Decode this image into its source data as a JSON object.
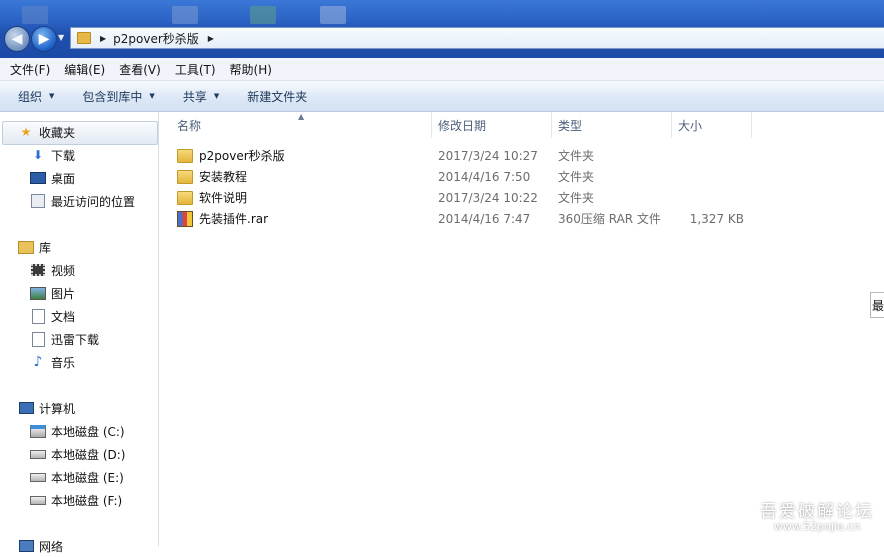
{
  "window": {
    "address_path": "p2pover秒杀版"
  },
  "menu": [
    "文件(F)",
    "编辑(E)",
    "查看(V)",
    "工具(T)",
    "帮助(H)"
  ],
  "toolbar": {
    "organize": "组织",
    "include_in_library": "包含到库中",
    "share": "共享",
    "new_folder": "新建文件夹"
  },
  "nav": {
    "favorites": "收藏夹",
    "downloads": "下载",
    "desktop": "桌面",
    "recent": "最近访问的位置",
    "libraries": "库",
    "videos": "视频",
    "pictures": "图片",
    "documents": "文档",
    "xunlei": "迅雷下载",
    "music": "音乐",
    "computer": "计算机",
    "drive_c": "本地磁盘 (C:)",
    "drive_d": "本地磁盘 (D:)",
    "drive_e": "本地磁盘 (E:)",
    "drive_f": "本地磁盘 (F:)",
    "network": "网络"
  },
  "columns": {
    "name": "名称",
    "modified": "修改日期",
    "type": "类型",
    "size": "大小"
  },
  "files": [
    {
      "name": "p2pover秒杀版",
      "modified": "2017/3/24 10:27",
      "type": "文件夹",
      "size": "",
      "icon": "folder-icon"
    },
    {
      "name": "安装教程",
      "modified": "2014/4/16 7:50",
      "type": "文件夹",
      "size": "",
      "icon": "folder-icon"
    },
    {
      "name": "软件说明",
      "modified": "2017/3/24 10:22",
      "type": "文件夹",
      "size": "",
      "icon": "folder-icon"
    },
    {
      "name": "先装插件.rar",
      "modified": "2014/4/16 7:47",
      "type": "360压缩 RAR 文件",
      "size": "1,327 KB",
      "icon": "rar-archive-icon"
    }
  ],
  "side_tab": "最",
  "watermark": {
    "title": "吾爱破解论坛",
    "url": "www.52pojie.cn"
  }
}
